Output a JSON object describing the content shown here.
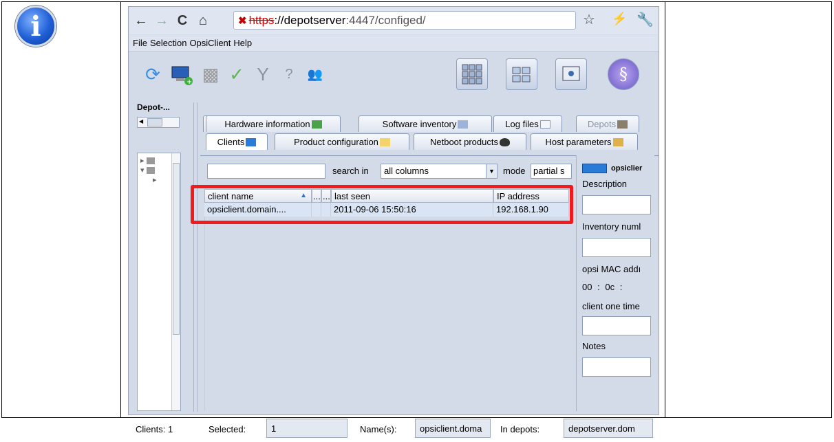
{
  "browser": {
    "url_scheme": "https",
    "url_host": "://depotserver",
    "url_rest": ":4447/configed/"
  },
  "menu": [
    "File",
    "Selection",
    "OpsiClient",
    "Help"
  ],
  "left": {
    "depot_label": "Depot-..."
  },
  "tabs_row1": [
    {
      "label": "Hardware information",
      "disabled": false
    },
    {
      "label": "Software inventory",
      "disabled": false
    },
    {
      "label": "Log files",
      "disabled": false
    },
    {
      "label": "Depots",
      "disabled": true
    }
  ],
  "tabs_row2": [
    {
      "label": "Clients",
      "active": true
    },
    {
      "label": "Product configuration",
      "active": false
    },
    {
      "label": "Netboot products",
      "active": false
    },
    {
      "label": "Host parameters",
      "active": false
    }
  ],
  "search": {
    "value": "",
    "search_in_label": "search in",
    "search_in_value": "all columns",
    "mode_label": "mode",
    "mode_value": "partial s"
  },
  "table": {
    "columns": [
      "client name",
      "...",
      "...",
      "last seen",
      "IP address"
    ],
    "rows": [
      [
        "opsiclient.domain....",
        "",
        "",
        "2011-09-06 15:50:16",
        "192.168.1.90"
      ]
    ]
  },
  "details": {
    "client_name": "opsiclier",
    "description_label": "Description",
    "inventory_label": "Inventory numl",
    "mac_label": "opsi MAC addı",
    "mac_part1": "00",
    "mac_sep1": ":",
    "mac_part2": "0c",
    "mac_sep2": ":",
    "onetime_label": "client one time",
    "notes_label": "Notes"
  },
  "status": {
    "clients_label": "Clients: 1",
    "selected_label": "Selected:",
    "selected_value": "1",
    "names_label": "Name(s):",
    "names_value": "opsiclient.doma",
    "depots_label": "In depots:",
    "depots_value": "depotserver.dom"
  },
  "colors": {
    "highlight": "#ee1c1c",
    "selected_row": "#d9e5f5",
    "app_bg": "#d4dbe8"
  }
}
